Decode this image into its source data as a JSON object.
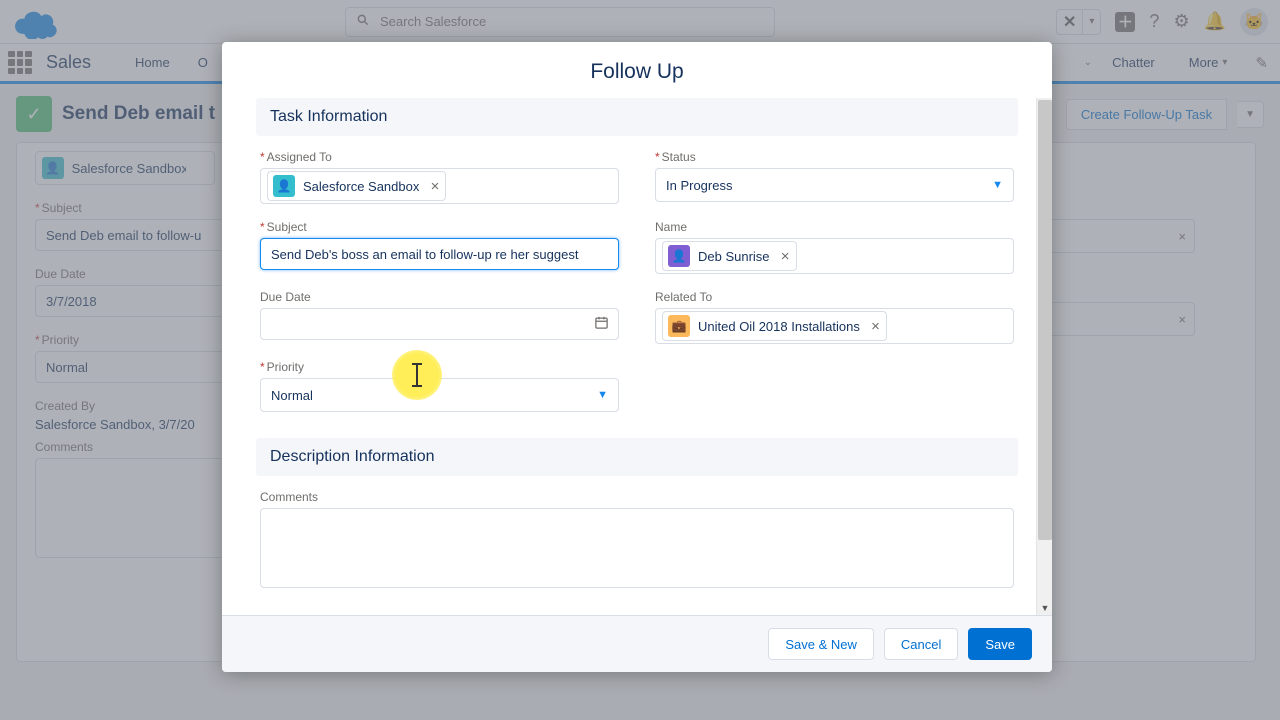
{
  "header": {
    "search_placeholder": "Search Salesforce",
    "star_icon": "✕",
    "star_caret": "▾",
    "plus_icon": "＋",
    "help_icon": "?",
    "gear_icon": "⚙",
    "bell_icon": "🔔"
  },
  "nav": {
    "app_name": "Sales",
    "home": "Home",
    "op": "O",
    "chatter": "Chatter",
    "more": "More",
    "more_caret": "▾",
    "caret_left": "⌄"
  },
  "page": {
    "title": "Send Deb email t",
    "create_btn": "Create Follow-Up Task",
    "bg": {
      "assigned_pill": "Salesforce Sandbox",
      "subject_label": "Subject",
      "subject_val": "Send Deb email to follow-u",
      "duedate_label": "Due Date",
      "duedate_val": "3/7/2018",
      "priority_label": "Priority",
      "priority_val": "Normal",
      "createdby_label": "Created By",
      "createdby_val": "Salesforce Sandbox, 3/7/20",
      "comments_label": "Comments"
    }
  },
  "modal": {
    "title": "Follow Up",
    "section1": "Task Information",
    "section2": "Description Information",
    "fields": {
      "assigned_label": "Assigned To",
      "assigned_val": "Salesforce Sandbox",
      "status_label": "Status",
      "status_val": "In Progress",
      "subject_label": "Subject",
      "subject_val": "Send Deb's boss an email to follow-up re her suggest",
      "name_label": "Name",
      "name_val": "Deb Sunrise",
      "duedate_label": "Due Date",
      "duedate_val": "",
      "related_label": "Related To",
      "related_val": "United Oil 2018 Installations",
      "priority_label": "Priority",
      "priority_val": "Normal",
      "comments_label": "Comments"
    },
    "buttons": {
      "save_new": "Save & New",
      "cancel": "Cancel",
      "save": "Save"
    }
  }
}
